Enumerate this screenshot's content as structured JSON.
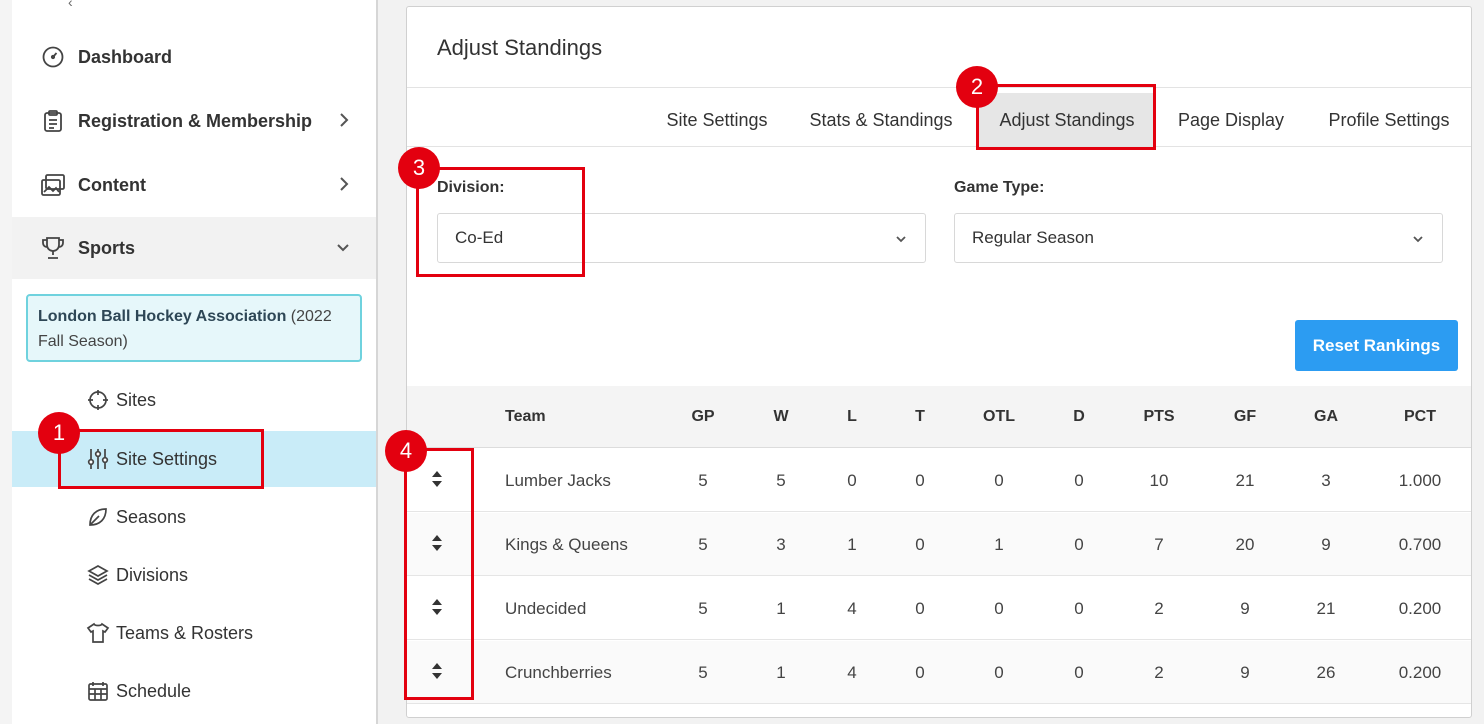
{
  "sidebar": {
    "nav": [
      {
        "label": "Dashboard",
        "icon": "dashboard-icon"
      },
      {
        "label": "Registration & Membership",
        "icon": "clipboard-icon"
      },
      {
        "label": "Content",
        "icon": "images-icon"
      },
      {
        "label": "Sports",
        "icon": "trophy-icon"
      }
    ],
    "association": {
      "name": "London Ball Hockey Association",
      "season": "(2022 Fall Season)"
    },
    "sub_items": [
      {
        "label": "Sites",
        "icon": "crosshair-icon"
      },
      {
        "label": "Site Settings",
        "icon": "sliders-icon"
      },
      {
        "label": "Seasons",
        "icon": "leaf-icon"
      },
      {
        "label": "Divisions",
        "icon": "layers-icon"
      },
      {
        "label": "Teams & Rosters",
        "icon": "shirt-icon"
      },
      {
        "label": "Schedule",
        "icon": "calendar-icon"
      }
    ]
  },
  "main": {
    "title": "Adjust Standings",
    "tabs": [
      {
        "label": "Site Settings"
      },
      {
        "label": "Stats & Standings"
      },
      {
        "label": "Adjust Standings",
        "active": true
      },
      {
        "label": "Page Display"
      },
      {
        "label": "Profile Settings"
      }
    ],
    "division": {
      "label": "Division:",
      "value": "Co-Ed"
    },
    "game_type": {
      "label": "Game Type:",
      "value": "Regular Season"
    },
    "reset_label": "Reset Rankings",
    "table": {
      "columns": [
        "Team",
        "GP",
        "W",
        "L",
        "T",
        "OTL",
        "D",
        "PTS",
        "GF",
        "GA",
        "PCT"
      ],
      "rows": [
        [
          "Lumber Jacks",
          "5",
          "5",
          "0",
          "0",
          "0",
          "0",
          "10",
          "21",
          "3",
          "1.000"
        ],
        [
          "Kings & Queens",
          "5",
          "3",
          "1",
          "0",
          "1",
          "0",
          "7",
          "20",
          "9",
          "0.700"
        ],
        [
          "Undecided",
          "5",
          "1",
          "4",
          "0",
          "0",
          "0",
          "2",
          "9",
          "21",
          "0.200"
        ],
        [
          "Crunchberries",
          "5",
          "1",
          "4",
          "0",
          "0",
          "0",
          "2",
          "9",
          "26",
          "0.200"
        ]
      ]
    }
  },
  "annotations": [
    "1",
    "2",
    "3",
    "4"
  ],
  "colors": {
    "accent": "#2c9cf2",
    "highlight": "#e3000f",
    "selected_bg": "#c9ecf8",
    "assoc_border": "#6fd2de"
  }
}
